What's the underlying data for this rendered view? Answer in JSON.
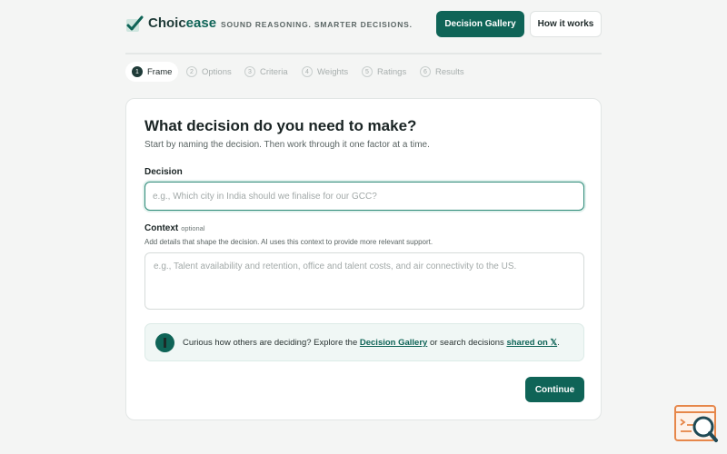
{
  "brand": {
    "name_main": "Choic",
    "name_accent": "ease",
    "tagline": "SOUND REASONING. SMARTER DECISIONS.",
    "accent_color": "#0f6457"
  },
  "nav": {
    "gallery_label": "Decision Gallery",
    "how_label": "How it works"
  },
  "steps": [
    {
      "num": "1",
      "label": "Frame",
      "active": true
    },
    {
      "num": "2",
      "label": "Options",
      "active": false
    },
    {
      "num": "3",
      "label": "Criteria",
      "active": false
    },
    {
      "num": "4",
      "label": "Weights",
      "active": false
    },
    {
      "num": "5",
      "label": "Ratings",
      "active": false
    },
    {
      "num": "6",
      "label": "Results",
      "active": false
    }
  ],
  "form": {
    "title": "What decision do you need to make?",
    "subtitle": "Start by naming the decision. Then work through it one factor at a time.",
    "decision_label": "Decision",
    "decision_placeholder": "e.g., Which city in India should we finalise for our GCC?",
    "decision_value": "",
    "context_label": "Context",
    "context_optional": "optional",
    "context_helper": "Add details that shape the decision. AI uses this context to provide more relevant support.",
    "context_placeholder": "e.g., Talent availability and retention, office and talent costs, and air connectivity to the US.",
    "context_value": "",
    "callout_prefix": "Curious how others are deciding? Explore the ",
    "callout_link1": "Decision Gallery",
    "callout_middle": " or search decisions ",
    "callout_link2": "shared on 𝕏",
    "callout_suffix": ".",
    "continue_label": "Continue"
  },
  "icons": {
    "logo": "check-mark-logo-icon",
    "callout": "info-icon",
    "corner": "search-document-icon"
  }
}
